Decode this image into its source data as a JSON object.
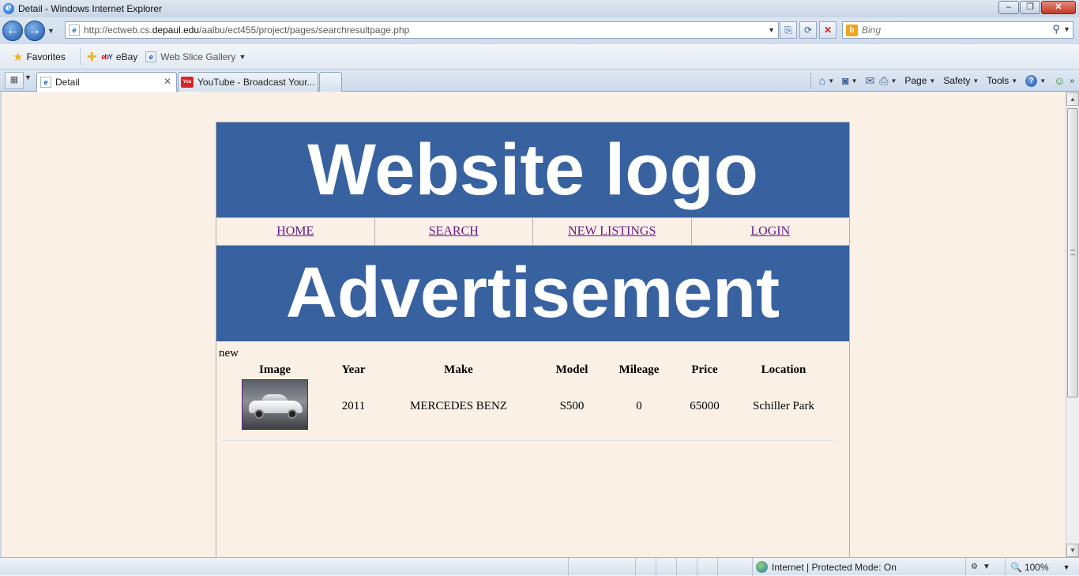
{
  "window": {
    "title": "Detail - Windows Internet Explorer",
    "minimize": "‒",
    "maximize": "❐",
    "close": "✕"
  },
  "address_bar": {
    "url_prefix": "http://ectweb.cs.",
    "url_domain": "depaul.edu",
    "url_suffix": "/aalbu/ect455/project/pages/searchresultpage.php"
  },
  "search": {
    "placeholder": "Bing"
  },
  "favorites_bar": {
    "favorites_label": "Favorites",
    "links": [
      {
        "label": "eBay"
      },
      {
        "label": "Web Slice Gallery"
      }
    ]
  },
  "tabs": [
    {
      "label": "Detail",
      "active": true
    },
    {
      "label": "YouTube - Broadcast Your...",
      "active": false
    }
  ],
  "command_bar": {
    "page_label": "Page",
    "safety_label": "Safety",
    "tools_label": "Tools"
  },
  "site": {
    "logo_text": "Website logo",
    "nav": [
      {
        "label": "HOME"
      },
      {
        "label": "SEARCH"
      },
      {
        "label": "NEW LISTINGS"
      },
      {
        "label": "LOGIN"
      }
    ],
    "ad_text": "Advertisement",
    "section_label": "new",
    "results": {
      "columns": [
        "Image",
        "Year",
        "Make",
        "Model",
        "Mileage",
        "Price",
        "Location"
      ],
      "rows": [
        {
          "year": "2011",
          "make": "MERCEDES BENZ",
          "model": "S500",
          "mileage": "0",
          "price": "65000",
          "location": "Schiller Park"
        }
      ]
    }
  },
  "status_bar": {
    "zone_text": "Internet | Protected Mode: On",
    "zoom_text": "100%"
  },
  "colors": {
    "banner_bg": "#3861a0",
    "page_bg": "#faf0e6",
    "link_color": "#6a1a8a"
  }
}
